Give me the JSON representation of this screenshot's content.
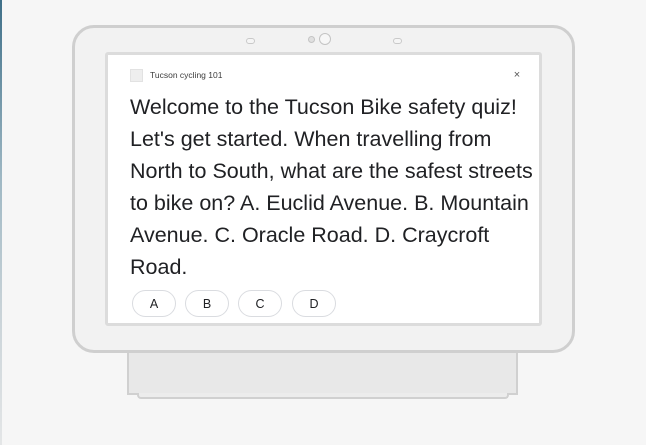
{
  "app": {
    "title": "Tucson cycling 101",
    "icon": "app-placeholder-icon",
    "close_icon": "close-icon",
    "close_glyph": "×"
  },
  "question": {
    "text": "Welcome to the Tucson Bike safety quiz! Let's get started. When travelling from North to South, what are the safest streets to bike on? A. Euclid Avenue. B. Mountain Avenue. C. Oracle Road. D. Craycroft Road."
  },
  "choices": [
    {
      "label": "A"
    },
    {
      "label": "B"
    },
    {
      "label": "C"
    },
    {
      "label": "D"
    }
  ],
  "colors": {
    "text": "#202124",
    "screen_bg": "#ffffff",
    "device_frame": "#cfcfcf",
    "chip_border": "#dadce0"
  }
}
